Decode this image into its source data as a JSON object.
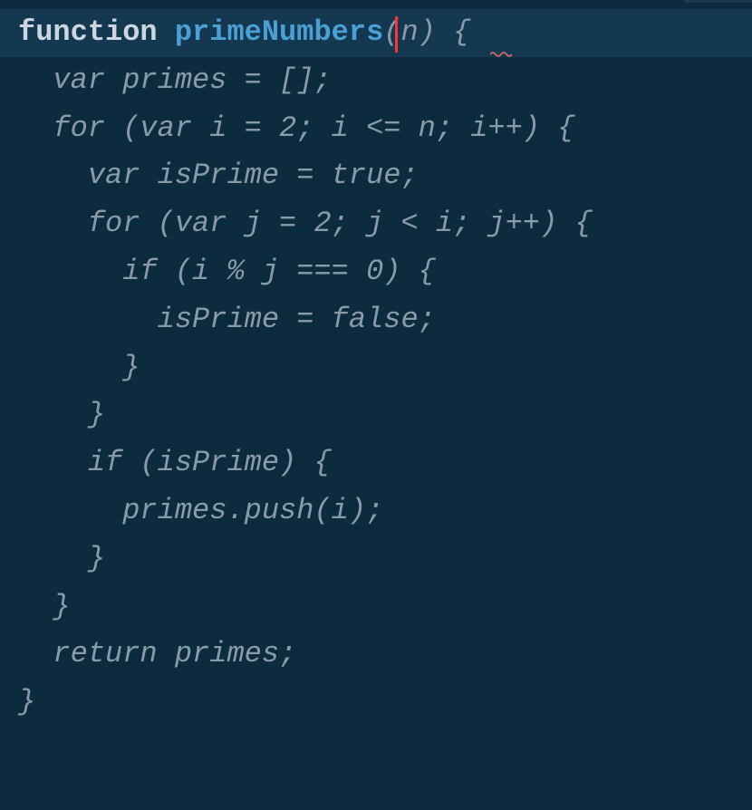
{
  "editor": {
    "function_keyword": "function ",
    "function_name": "primeNumbers",
    "function_params": "(n) {",
    "lines": [
      "  var primes = [];",
      "  for (var i = 2; i <= n; i++) {",
      "    var isPrime = true;",
      "    for (var j = 2; j < i; j++) {",
      "      if (i % j === 0) {",
      "        isPrime = false;",
      "      }",
      "    }",
      "    if (isPrime) {",
      "      primes.push(i);",
      "    }",
      "  }",
      "  return primes;",
      "}"
    ]
  }
}
